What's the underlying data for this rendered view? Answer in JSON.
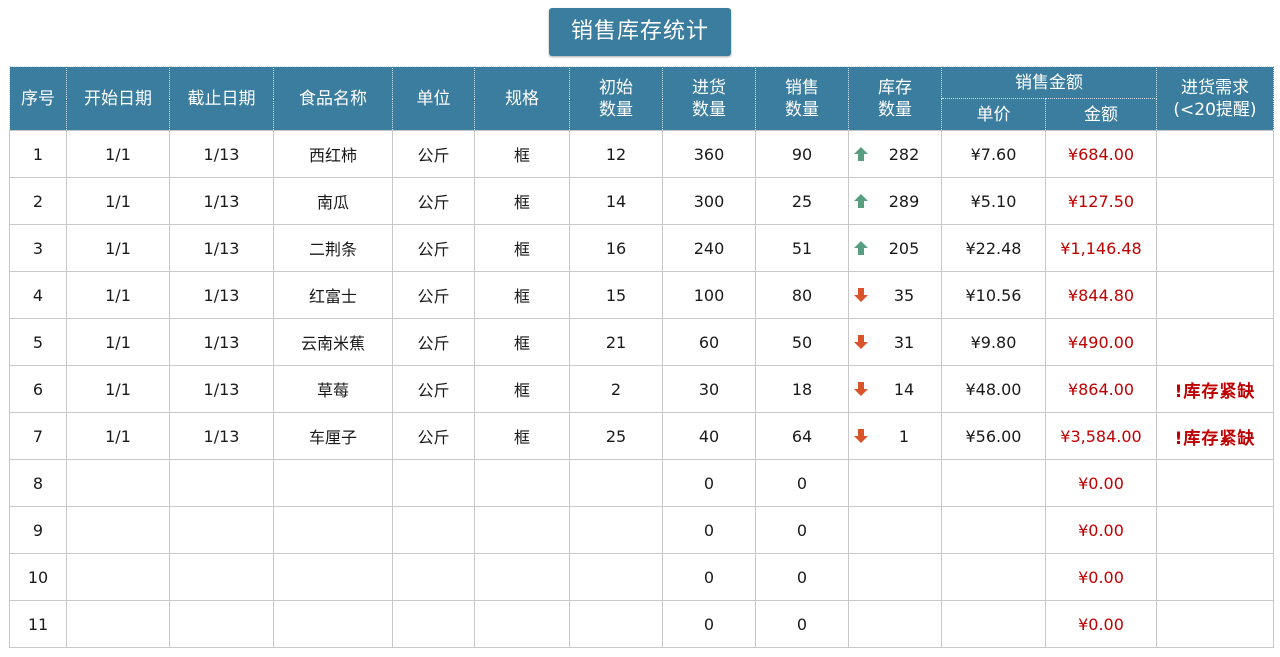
{
  "title": "销售库存统计",
  "headers": {
    "index": "序号",
    "start_date": "开始日期",
    "end_date": "截止日期",
    "food_name": "食品名称",
    "unit": "单位",
    "spec": "规格",
    "initial_qty_1": "初始",
    "initial_qty_2": "数量",
    "purchase_qty_1": "进货",
    "purchase_qty_2": "数量",
    "sales_qty_1": "销售",
    "sales_qty_2": "数量",
    "stock_qty_1": "库存",
    "stock_qty_2": "数量",
    "sales_amount": "销售金额",
    "unit_price": "单价",
    "amount": "金额",
    "purchase_need_1": "进货需求",
    "purchase_need_2": "(<20提醒)"
  },
  "colors": {
    "header_bg": "#3a7d9f",
    "amount_red": "#c00000",
    "arrow_up": "#5a9e82",
    "arrow_down": "#d9532b"
  },
  "rows": [
    {
      "index": "1",
      "start": "1/1",
      "end": "1/13",
      "name": "西红柿",
      "unit": "公斤",
      "spec": "框",
      "initial": "12",
      "purchase": "360",
      "sales": "90",
      "trend": "up",
      "stock": "282",
      "price": "¥7.60",
      "amount": "¥684.00",
      "alert": ""
    },
    {
      "index": "2",
      "start": "1/1",
      "end": "1/13",
      "name": "南瓜",
      "unit": "公斤",
      "spec": "框",
      "initial": "14",
      "purchase": "300",
      "sales": "25",
      "trend": "up",
      "stock": "289",
      "price": "¥5.10",
      "amount": "¥127.50",
      "alert": ""
    },
    {
      "index": "3",
      "start": "1/1",
      "end": "1/13",
      "name": "二荆条",
      "unit": "公斤",
      "spec": "框",
      "initial": "16",
      "purchase": "240",
      "sales": "51",
      "trend": "up",
      "stock": "205",
      "price": "¥22.48",
      "amount": "¥1,146.48",
      "alert": ""
    },
    {
      "index": "4",
      "start": "1/1",
      "end": "1/13",
      "name": "红富士",
      "unit": "公斤",
      "spec": "框",
      "initial": "15",
      "purchase": "100",
      "sales": "80",
      "trend": "down",
      "stock": "35",
      "price": "¥10.56",
      "amount": "¥844.80",
      "alert": ""
    },
    {
      "index": "5",
      "start": "1/1",
      "end": "1/13",
      "name": "云南米蕉",
      "unit": "公斤",
      "spec": "框",
      "initial": "21",
      "purchase": "60",
      "sales": "50",
      "trend": "down",
      "stock": "31",
      "price": "¥9.80",
      "amount": "¥490.00",
      "alert": ""
    },
    {
      "index": "6",
      "start": "1/1",
      "end": "1/13",
      "name": "草莓",
      "unit": "公斤",
      "spec": "框",
      "initial": "2",
      "purchase": "30",
      "sales": "18",
      "trend": "down",
      "stock": "14",
      "price": "¥48.00",
      "amount": "¥864.00",
      "alert": "!库存紧缺"
    },
    {
      "index": "7",
      "start": "1/1",
      "end": "1/13",
      "name": "车厘子",
      "unit": "公斤",
      "spec": "框",
      "initial": "25",
      "purchase": "40",
      "sales": "64",
      "trend": "down",
      "stock": "1",
      "price": "¥56.00",
      "amount": "¥3,584.00",
      "alert": "!库存紧缺"
    },
    {
      "index": "8",
      "start": "",
      "end": "",
      "name": "",
      "unit": "",
      "spec": "",
      "initial": "",
      "purchase": "0",
      "sales": "0",
      "trend": "",
      "stock": "",
      "price": "",
      "amount": "¥0.00",
      "alert": ""
    },
    {
      "index": "9",
      "start": "",
      "end": "",
      "name": "",
      "unit": "",
      "spec": "",
      "initial": "",
      "purchase": "0",
      "sales": "0",
      "trend": "",
      "stock": "",
      "price": "",
      "amount": "¥0.00",
      "alert": ""
    },
    {
      "index": "10",
      "start": "",
      "end": "",
      "name": "",
      "unit": "",
      "spec": "",
      "initial": "",
      "purchase": "0",
      "sales": "0",
      "trend": "",
      "stock": "",
      "price": "",
      "amount": "¥0.00",
      "alert": ""
    },
    {
      "index": "11",
      "start": "",
      "end": "",
      "name": "",
      "unit": "",
      "spec": "",
      "initial": "",
      "purchase": "0",
      "sales": "0",
      "trend": "",
      "stock": "",
      "price": "",
      "amount": "¥0.00",
      "alert": ""
    }
  ]
}
